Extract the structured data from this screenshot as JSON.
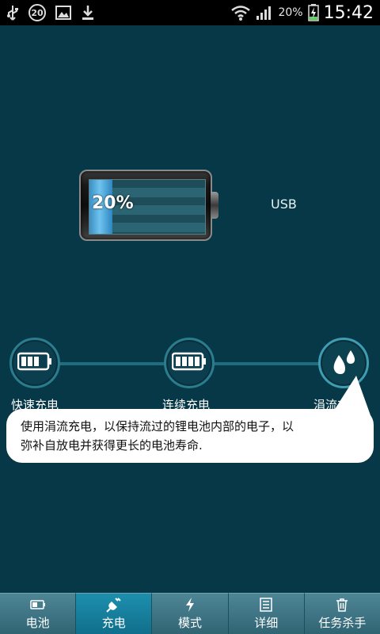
{
  "status_bar": {
    "notification_count": "20",
    "battery_percent": "20%",
    "time": "15:42",
    "icons": [
      "usb-icon",
      "notification-badge",
      "image-icon",
      "download-icon",
      "wifi-icon",
      "signal-icon",
      "battery-charging-icon"
    ]
  },
  "battery": {
    "level_percent": "20%",
    "level_fraction": 0.2,
    "source": "USB"
  },
  "modes": {
    "items": [
      {
        "label": "快速充电",
        "icon": "battery-icon"
      },
      {
        "label": "连续充电",
        "icon": "battery-icon"
      },
      {
        "label": "涓流充电",
        "icon": "water-drops-icon",
        "active": true
      }
    ]
  },
  "tooltip": {
    "line1": "使用涓流充电，以保持流过的锂电池内部的电子，以",
    "line2": "弥补自放电并获得更长的电池寿命."
  },
  "bottom_nav": {
    "items": [
      {
        "label": "电池",
        "icon": "battery-icon"
      },
      {
        "label": "充电",
        "icon": "plug-icon",
        "active": true
      },
      {
        "label": "模式",
        "icon": "lightning-icon"
      },
      {
        "label": "详细",
        "icon": "list-icon"
      },
      {
        "label": "任务杀手",
        "icon": "trash-icon"
      }
    ]
  },
  "colors": {
    "background": "#073847",
    "accent": "#1d8fae",
    "battery_fill": "#6ec3ee"
  }
}
